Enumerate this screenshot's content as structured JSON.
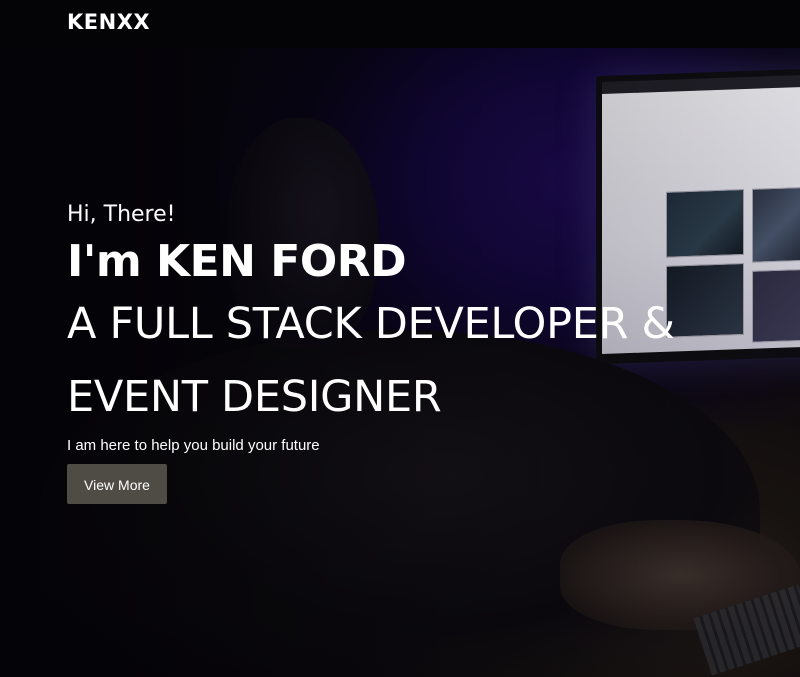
{
  "navbar": {
    "brand": "KENXX"
  },
  "hero": {
    "greeting": "Hi, There!",
    "name": "I'm KEN FORD",
    "role": "A FULL STACK DEVELOPER & EVENT DESIGNER",
    "tagline": "I am here to help you build your future",
    "cta_label": "View More"
  },
  "colors": {
    "navbar_bg": "#040306",
    "text": "#ffffff",
    "cta_bg": "#4e4c45",
    "background_accent": "#1b0a4a"
  }
}
